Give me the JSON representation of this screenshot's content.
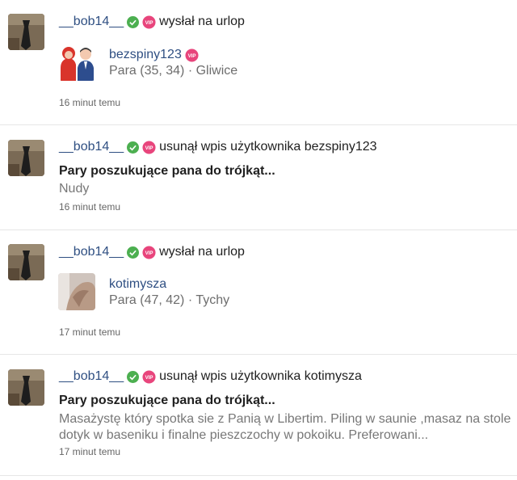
{
  "colors": {
    "username": "#2f4f82",
    "verified": "#4caf50",
    "vip": "#e8457c",
    "muted": "#777777"
  },
  "feed": {
    "items": [
      {
        "user": "__bob14__",
        "action": "wysłał na urlop",
        "card": {
          "name": "bezspiny123",
          "meta": "Para (35, 34) · Gliwice",
          "avatar_icon": "couple-icon"
        },
        "time": "16 minut temu"
      },
      {
        "user": "__bob14__",
        "action": "usunął wpis użytkownika bezspiny123",
        "post": {
          "title": "Pary poszukujące pana do trójkąt...",
          "body": "Nudy"
        },
        "time": "16 minut temu"
      },
      {
        "user": "__bob14__",
        "action": "wysłał na urlop",
        "card": {
          "name": "kotimysza",
          "meta": "Para (47, 42) · Tychy",
          "avatar_icon": "photo-thumbnail"
        },
        "time": "17 minut temu"
      },
      {
        "user": "__bob14__",
        "action": "usunął wpis użytkownika kotimysza",
        "post": {
          "title": "Pary poszukujące pana do trójkąt...",
          "body": "Masażystę który spotka sie z Panią w Libertim. Piling w saunie ,masaz na stole dotyk w baseniku i finalne pieszczochy w pokoiku. Preferowani..."
        },
        "time": "17 minut temu"
      }
    ]
  }
}
